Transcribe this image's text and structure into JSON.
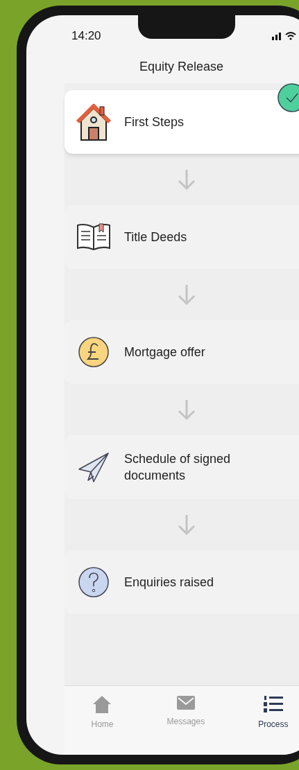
{
  "status_bar": {
    "time": "14:20"
  },
  "header": {
    "title": "Equity Release"
  },
  "steps": [
    {
      "kind": "house",
      "label": "First Steps",
      "done": true
    },
    {
      "kind": "book",
      "label": "Title Deeds",
      "done": false
    },
    {
      "kind": "pound",
      "label": "Mortgage offer",
      "done": false
    },
    {
      "kind": "plane",
      "label": "Schedule of signed documents",
      "done": false
    },
    {
      "kind": "question",
      "label": "Enquiries raised",
      "done": false
    }
  ],
  "tab_bar": [
    {
      "kind": "home",
      "label": "Home",
      "selected": false
    },
    {
      "kind": "messages",
      "label": "Messages",
      "selected": false
    },
    {
      "kind": "process",
      "label": "Process",
      "selected": true
    }
  ]
}
